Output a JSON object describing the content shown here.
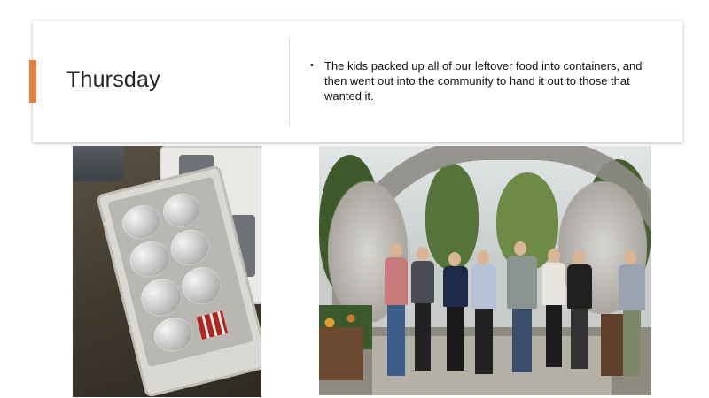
{
  "slide": {
    "title": "Thursday",
    "bullets": [
      "The kids packed up all of our leftover food into containers, and then went out into the community to hand it out to those that wanted it."
    ],
    "bullet_symbol": "•"
  },
  "colors": {
    "accent": "#e8803a",
    "text": "#222222",
    "card_background": "#ffffff"
  },
  "images": {
    "left": "photo of an open cooler filled with foil-wrapped food containers",
    "right": "group photo of people standing under a large antler arch"
  }
}
